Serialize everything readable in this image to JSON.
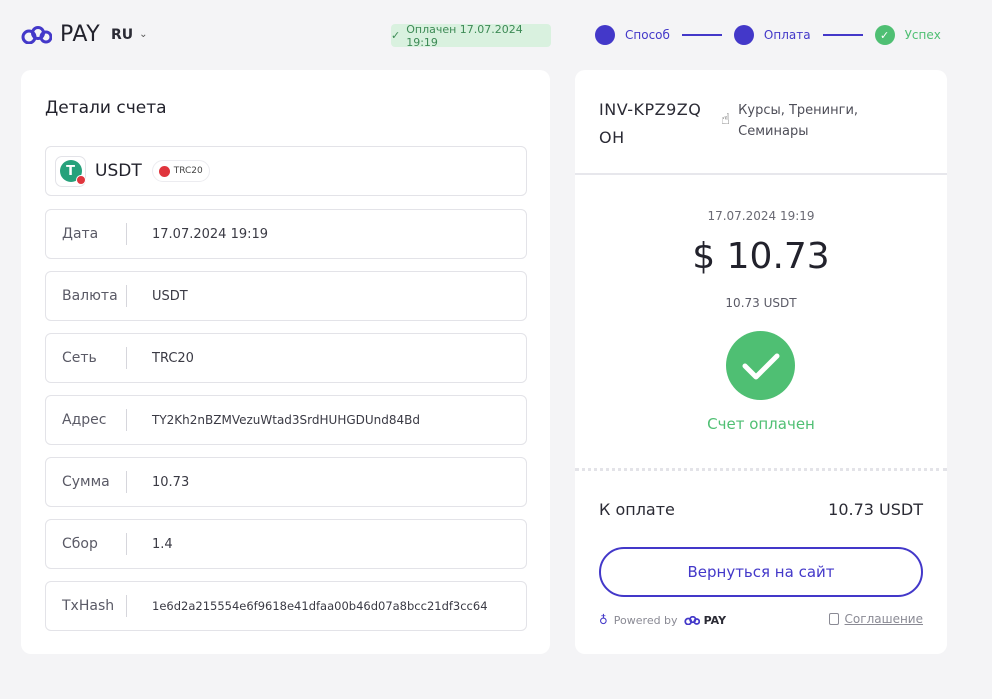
{
  "header": {
    "logo_text": "PAY",
    "language": "RU",
    "status_badge": "Оплачен 17.07.2024 19:19",
    "steps": [
      {
        "label": "Способ",
        "state": "active"
      },
      {
        "label": "Оплата",
        "state": "active"
      },
      {
        "label": "Успех",
        "state": "done"
      }
    ]
  },
  "details": {
    "title": "Детали счета",
    "coin": {
      "name": "USDT",
      "network_badge": "TRC20"
    },
    "rows": [
      {
        "label": "Дата",
        "value": "17.07.2024 19:19"
      },
      {
        "label": "Валюта",
        "value": "USDT"
      },
      {
        "label": "Сеть",
        "value": "TRC20"
      },
      {
        "label": "Адрес",
        "value": "TY2Kh2nBZMVezuWtad3SrdHUHGDUnd84Bd"
      },
      {
        "label": "Сумма",
        "value": "10.73"
      },
      {
        "label": "Сбор",
        "value": "1.4"
      },
      {
        "label": "TxHash",
        "value": "1e6d2a215554e6f9618e41dfaa00b46d07a8bcc21df3cc64"
      }
    ]
  },
  "summary": {
    "invoice_number": "INV-KPZ9ZQOH",
    "category": "Курсы, Тренинги, Семинары",
    "date": "17.07.2024 19:19",
    "amount": "$ 10.73",
    "crypto_amount": "10.73 USDT",
    "status": "Счет оплачен",
    "total_label": "К оплате",
    "total_value": "10.73 USDT",
    "return_button": "Вернуться на сайт",
    "powered_by": "Powered by",
    "powered_brand": "PAY",
    "agreement": "Соглашение"
  },
  "colors": {
    "accent": "#4338c9",
    "success": "#4fbf73",
    "background": "#f4f4f6"
  }
}
